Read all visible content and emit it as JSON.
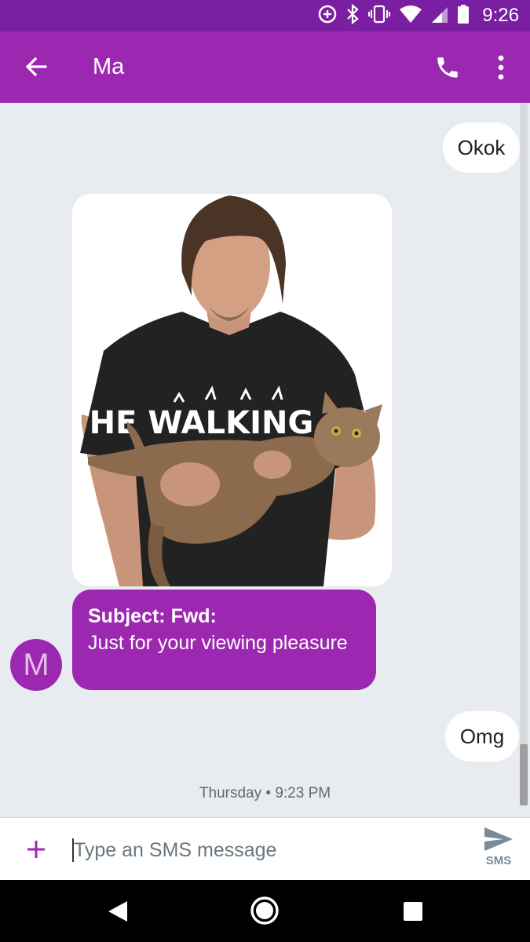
{
  "status_bar": {
    "time": "9:26",
    "icons": [
      "data-saver-icon",
      "bluetooth-icon",
      "vibrate-icon",
      "wifi-icon",
      "cell-signal-icon",
      "battery-icon"
    ]
  },
  "app_bar": {
    "contact_name": "Ma",
    "icons": [
      "back-arrow-icon",
      "phone-icon",
      "more-vert-icon"
    ],
    "color": "#9c27b0"
  },
  "conversation": {
    "messages": [
      {
        "direction": "outgoing",
        "text": "Okok"
      },
      {
        "direction": "incoming",
        "type": "mms-image",
        "image_text": "THE WALKING CAT"
      },
      {
        "direction": "incoming",
        "subject": "Subject: Fwd:",
        "text": "Just for your viewing pleasure",
        "avatar_letter": "M"
      },
      {
        "direction": "outgoing",
        "text": "Omg"
      }
    ],
    "timestamp": "Thursday • 9:23 PM"
  },
  "compose": {
    "placeholder": "Type an SMS message",
    "value": "",
    "send_label": "SMS",
    "icons": [
      "add-icon",
      "send-icon"
    ]
  },
  "nav_bar": {
    "icons": [
      "nav-back-icon",
      "nav-home-icon",
      "nav-recents-icon"
    ]
  },
  "colors": {
    "accent": "#9c27b0",
    "status_bar": "#7b1fa2",
    "background": "#e8ebef"
  }
}
